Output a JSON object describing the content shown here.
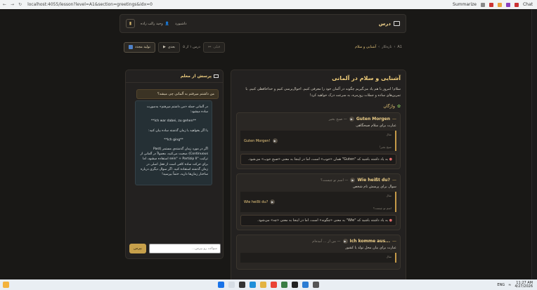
{
  "browser": {
    "url": "localhost:4055/lesson?level=A1&section=greetings&idx=0",
    "summarize_label": "Summarize",
    "chat_label": "Chat"
  },
  "header": {
    "brand": "درس",
    "dashboard": "داشبورد",
    "user": "وحید رالب زاده"
  },
  "lesson_bar": {
    "crumb_level": "A1",
    "crumb_sep": "›",
    "crumb_vocab": "تازه‌کار",
    "crumb_current": "آشنایی و سلام",
    "prev_label": "قبلی",
    "position": "درس ۱ از ۵",
    "next_label": "بعدی",
    "regen_label": "تولید مجدد"
  },
  "lesson": {
    "title": "آشنایی و سلام در آلمانی",
    "intro": "سلام! امروز با هم یاد می‌گیریم چگونه در آلمان خود را معرفی کنیم. احوال‌پرسی کنیم و خداحافظی کنیم. با تمرین‌های ساده و جملات روزمره، به سرعت درک خواهید کرد!",
    "vocab_heading": "واژگان",
    "vocab_icon": "sprout-icon",
    "cards": [
      {
        "word": "Guten Morgen",
        "meaning": "— صبح بخیر",
        "description": "عبارت برای سلام صبحگاهی",
        "example_label": "مثال",
        "example_de": "Guten Morgen!",
        "example_fa": "صبح بخیر!",
        "tip": "به یاد داشته باشید که \"Guten\" همان «خوب» است، اما در اینجا به معنی «صبح خوب» می‌شود."
      },
      {
        "word": "Wie heißt du?",
        "meaning": "— اسم تو چیست؟",
        "description": "سوال برای پرسش نام شخص",
        "example_label": "مثال",
        "example_de": "Wie heißt du?",
        "example_fa": "اسم تو چیست؟",
        "tip": "به یاد داشته باشید که \"Wie\" به معنی «چگونه» است، اما در اینجا به معنی «چه» می‌شود."
      },
      {
        "word": "Ich komme aus...",
        "meaning": "— من از ... آمده‌ام",
        "description": "عبارت برای بیان محل تولد یا کشور",
        "example_label": "مثال",
        "example_de": "",
        "example_fa": "",
        "tip": ""
      }
    ]
  },
  "chat": {
    "title": "پرسش از معلم",
    "user_message": "من داشتم میرفتم به آلمانی چی میشه؟",
    "bot_paragraphs": [
      "در آلمانی جمله «من داشتم میرفتم» به‌صورت ساده میشود:",
      "**Ich war dabei, zu gehen**",
      "یا اگر بخواهید با زمان گذشته ساده بیان کنید:",
      "**Ich ging**",
      "اگر در مورد زمان گذشته‌ی مستمر (Past Continuous) صحبت می‌کنید، معمولاً در آلمانی از ترکیب \"sein\" + Partizip II استفاده میشود، اما برای حرکت ساده کافی است از فعل اصلی در زمان گذشته استفاده کنید. اگر سوال دیگری درباره ساختار زمان‌ها دارید، حتماً بپرسید!"
    ],
    "send_label": "بپرس",
    "input_placeholder": "سوالت رو بپرس..."
  },
  "taskbar": {
    "search_placeholder": "Search",
    "lang": "ENG",
    "time": "11:27 AM",
    "date": "4/27/2026"
  }
}
